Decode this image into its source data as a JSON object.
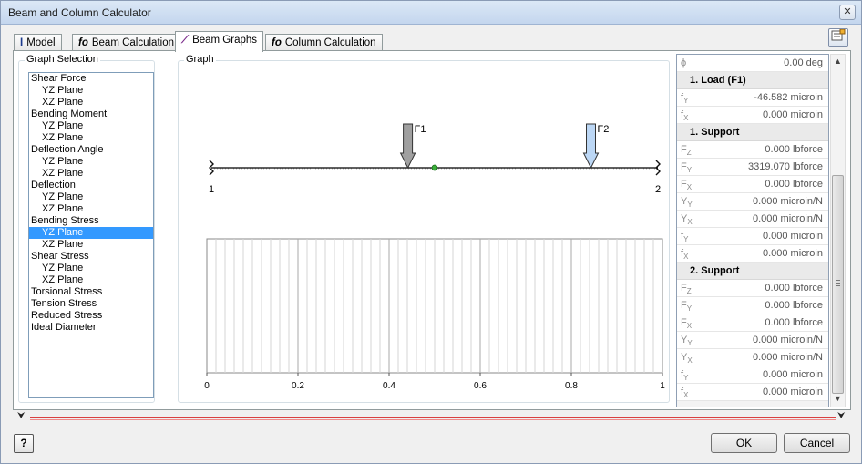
{
  "window": {
    "title": "Beam and Column Calculator",
    "close_glyph": "✕"
  },
  "tabs": [
    {
      "icon": "I",
      "label": "Model"
    },
    {
      "icon": "fo",
      "label": "Beam Calculation"
    },
    {
      "icon": "⟋",
      "label": "Beam Graphs"
    },
    {
      "icon": "fo",
      "label": "Column Calculation"
    }
  ],
  "toolbar": {
    "icon": "properties-icon"
  },
  "graph_selection": {
    "label": "Graph Selection",
    "items": [
      {
        "label": "Shear Force",
        "sub": false
      },
      {
        "label": "YZ Plane",
        "sub": true
      },
      {
        "label": "XZ Plane",
        "sub": true
      },
      {
        "label": "Bending Moment",
        "sub": false
      },
      {
        "label": "YZ Plane",
        "sub": true
      },
      {
        "label": "XZ Plane",
        "sub": true
      },
      {
        "label": "Deflection Angle",
        "sub": false
      },
      {
        "label": "YZ Plane",
        "sub": true
      },
      {
        "label": "XZ Plane",
        "sub": true
      },
      {
        "label": "Deflection",
        "sub": false
      },
      {
        "label": "YZ Plane",
        "sub": true
      },
      {
        "label": "XZ Plane",
        "sub": true
      },
      {
        "label": "Bending Stress",
        "sub": false
      },
      {
        "label": "YZ Plane",
        "sub": true
      },
      {
        "label": "XZ Plane",
        "sub": true
      },
      {
        "label": "Shear Stress",
        "sub": false
      },
      {
        "label": "YZ Plane",
        "sub": true
      },
      {
        "label": "XZ Plane",
        "sub": true
      },
      {
        "label": "Torsional Stress",
        "sub": false
      },
      {
        "label": "Tension Stress",
        "sub": false
      },
      {
        "label": "Reduced Stress",
        "sub": false
      },
      {
        "label": "Ideal Diameter",
        "sub": false
      }
    ],
    "selected_index": 13
  },
  "graph": {
    "label": "Graph",
    "beam": {
      "loads": [
        {
          "label": "F1",
          "position": 0.44,
          "color": "#a0a0a0"
        },
        {
          "label": "F2",
          "position": 0.85,
          "color": "#bcd7f5"
        }
      ],
      "supports": [
        {
          "label": "1",
          "position": 0.0
        },
        {
          "label": "2",
          "position": 1.0
        }
      ],
      "midpoint": 0.5
    },
    "chart_data": {
      "type": "line",
      "x_ticks": [
        "0",
        "0.2",
        "0.4",
        "0.6",
        "0.8",
        "1"
      ],
      "xlim": [
        0,
        1
      ],
      "grid": true,
      "series": []
    }
  },
  "properties": [
    {
      "kind": "row",
      "sym": "ϕ",
      "value": "0.00 deg"
    },
    {
      "kind": "header",
      "label": "1. Load (F1)"
    },
    {
      "kind": "row",
      "sym": "f_Y",
      "value": "-46.582 microin"
    },
    {
      "kind": "row",
      "sym": "f_X",
      "value": "0.000 microin"
    },
    {
      "kind": "header",
      "label": "1. Support"
    },
    {
      "kind": "row",
      "sym": "F_Z",
      "value": "0.000 lbforce"
    },
    {
      "kind": "row",
      "sym": "F_Y",
      "value": "3319.070 lbforce"
    },
    {
      "kind": "row",
      "sym": "F_X",
      "value": "0.000 lbforce"
    },
    {
      "kind": "row",
      "sym": "Y_Y",
      "value": "0.000 microin/N"
    },
    {
      "kind": "row",
      "sym": "Y_X",
      "value": "0.000 microin/N"
    },
    {
      "kind": "row",
      "sym": "f_Y",
      "value": "0.000 microin"
    },
    {
      "kind": "row",
      "sym": "f_X",
      "value": "0.000 microin"
    },
    {
      "kind": "header",
      "label": "2. Support"
    },
    {
      "kind": "row",
      "sym": "F_Z",
      "value": "0.000 lbforce"
    },
    {
      "kind": "row",
      "sym": "F_Y",
      "value": "0.000 lbforce"
    },
    {
      "kind": "row",
      "sym": "F_X",
      "value": "0.000 lbforce"
    },
    {
      "kind": "row",
      "sym": "Y_Y",
      "value": "0.000 microin/N"
    },
    {
      "kind": "row",
      "sym": "Y_X",
      "value": "0.000 microin/N"
    },
    {
      "kind": "row",
      "sym": "f_Y",
      "value": "0.000 microin"
    },
    {
      "kind": "row",
      "sym": "f_X",
      "value": "0.000 microin"
    }
  ],
  "buttons": {
    "ok": "OK",
    "cancel": "Cancel",
    "help": "?"
  },
  "colors": {
    "selection": "#3399ff",
    "splitter": "#d94040"
  }
}
